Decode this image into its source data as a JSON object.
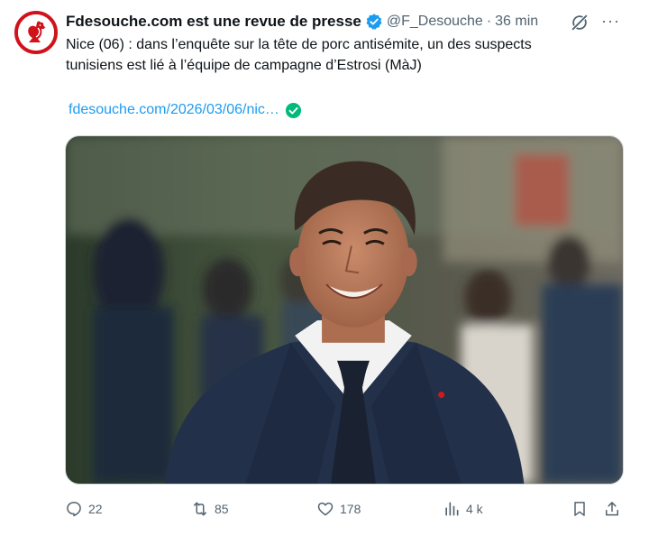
{
  "author": {
    "name": "Fdesouche.com est une revue de presse",
    "handle": "@F_Desouche",
    "separator": "·",
    "time": "36 min",
    "avatar_icon": "rooster-logo",
    "verified_icon": "verified-badge-icon",
    "brand_color": "#d0121b"
  },
  "tweet": {
    "text_line1": "Nice (06) : dans l’enquête sur la tête de porc antisémite, un des suspects",
    "text_line2": "tunisiens est lié à l’équipe de campagne d’Estrosi (MàJ)",
    "link": "fdesouche.com/2026/03/06/nic…",
    "link_color": "#1d9bf0",
    "link_check_color": "#00ba7c"
  },
  "media": {
    "icon": "photo-of-smiling-man-in-suit"
  },
  "actions": {
    "replies": "22",
    "retweets": "85",
    "likes": "178",
    "views": "4 k"
  },
  "colors": {
    "text": "#0f1419",
    "secondary": "#536471",
    "accent": "#1d9bf0"
  }
}
